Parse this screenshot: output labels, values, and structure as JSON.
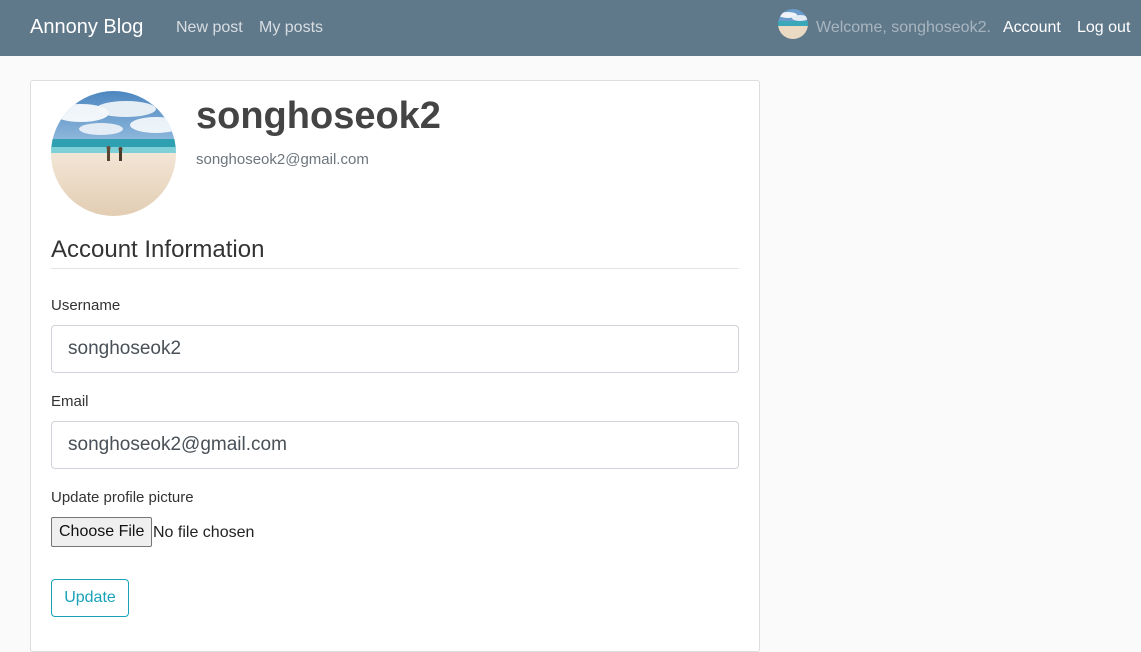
{
  "navbar": {
    "brand": "Annony Blog",
    "links": [
      "New post",
      "My posts"
    ],
    "welcome": "Welcome, songhoseok2.",
    "account": "Account",
    "logout": "Log out"
  },
  "profile": {
    "username": "songhoseok2",
    "email": "songhoseok2@gmail.com"
  },
  "form": {
    "legend": "Account Information",
    "username_label": "Username",
    "username_value": "songhoseok2",
    "email_label": "Email",
    "email_value": "songhoseok2@gmail.com",
    "picture_label": "Update profile picture",
    "choose_file": "Choose File",
    "file_status": "No file chosen",
    "submit": "Update"
  },
  "colors": {
    "navbar": "#5f788a",
    "accent": "#17a2b8"
  },
  "icons": {
    "avatar": "beach-photo"
  }
}
